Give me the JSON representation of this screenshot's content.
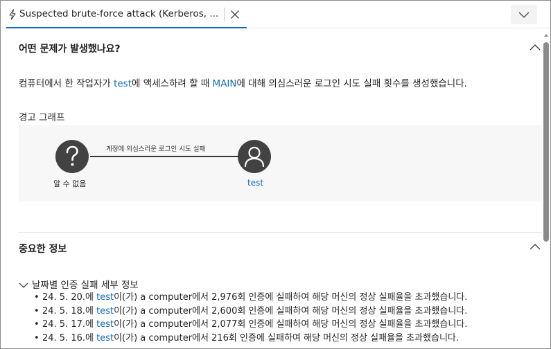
{
  "tab": {
    "title": "Suspected brute-force attack (Kerberos, ..."
  },
  "section1": {
    "header": "어떤 문제가 발생했나요?",
    "description": {
      "part1": "컴퓨터에서 한 작업자가 ",
      "account": "test",
      "part2": "에 액세스하려 할 때 ",
      "target": "MAIN",
      "part3": "에 대해 의심스러운 로그인 시도 실패 횟수를 생성했습니다."
    },
    "graph_title": "경고 그래프",
    "graph": {
      "edge_label": "계정에 의심스러운 로그인 시도 실패",
      "source_label": "알 수 없음",
      "target_label": "test"
    }
  },
  "section2": {
    "header": "중요한 정보",
    "subheader": "날짜별 인증 실패 세부 정보",
    "items": [
      {
        "date": "24. 5. 20.에 ",
        "account": "test",
        "rest": "이(가) a computer에서 2,976회 인증에 실패하여 해당 머신의 정상 실패율을 초과했습니다."
      },
      {
        "date": "24. 5. 18.에 ",
        "account": "test",
        "rest": "이(가) a computer에서 2,600회 인증에 실패하여 해당 머신의 정상 실패율을 초과했습니다."
      },
      {
        "date": "24. 5. 17.에 ",
        "account": "test",
        "rest": "이(가) a computer에서 2,077회 인증에 실패하여 해당 머신의 정상 실패율을 초과했습니다."
      },
      {
        "date": "24. 5. 16.에 ",
        "account": "test",
        "rest": "이(가) a computer에서 216회 인증에 실패하여 해당 머신의 정상 실패율을 초과했습니다."
      }
    ]
  },
  "colors": {
    "accent": "#0f6cbd",
    "node": "#424242",
    "graph_bg": "#f7f7f7"
  },
  "icons": {
    "tab": "lightning-bolt-icon",
    "close": "close-icon",
    "dropdown": "chevron-down-icon",
    "collapse": "chevron-up-icon",
    "unknown_node": "question-mark-icon",
    "user_node": "user-icon"
  }
}
